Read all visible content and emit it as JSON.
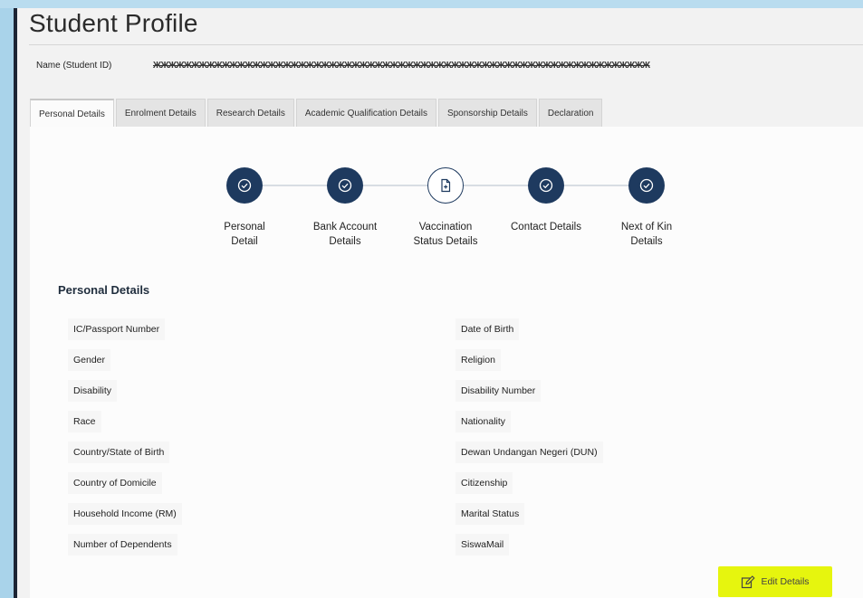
{
  "page": {
    "title": "Student Profile"
  },
  "student": {
    "name_label": "Name (Student ID)",
    "name_value": "ЖЖЖЖЖЖЖЖЖЖЖЖЖЖЖЖЖЖЖЖЖЖЖЖЖЖЖЖЖЖЖЖЖЖЖЖЖЖЖЖЖЖЖЖЖЖЖЖЖЖЖЖЖЖЖЖЖЖЖЖЖЖЖЖЖ"
  },
  "tabs": [
    {
      "label": "Personal Details",
      "active": true
    },
    {
      "label": "Enrolment Details"
    },
    {
      "label": "Research Details"
    },
    {
      "label": "Academic Qualification Details"
    },
    {
      "label": "Sponsorship Details"
    },
    {
      "label": "Declaration"
    }
  ],
  "stepper": {
    "steps": [
      {
        "label_line1": "Personal",
        "label_line2": "Detail",
        "state": "done",
        "icon": "check-circle-icon"
      },
      {
        "label_line1": "Bank Account",
        "label_line2": "Details",
        "state": "done",
        "icon": "check-circle-icon"
      },
      {
        "label_line1": "Vaccination",
        "label_line2": "Status Details",
        "state": "current",
        "icon": "document-plus-icon"
      },
      {
        "label_line1": "Contact Details",
        "label_line2": "",
        "state": "done",
        "icon": "check-circle-icon"
      },
      {
        "label_line1": "Next of Kin",
        "label_line2": "Details",
        "state": "done",
        "icon": "check-circle-icon"
      }
    ],
    "done_color": "#1e3a5f"
  },
  "section": {
    "title": "Personal Details"
  },
  "fields_left": [
    "IC/Passport Number",
    "Gender",
    "Disability",
    "Race",
    "Country/State of Birth",
    "Country of Domicile",
    "Household Income (RM)",
    "Number of Dependents"
  ],
  "fields_right": [
    "Date of Birth",
    "Religion",
    "Disability Number",
    "Nationality",
    "Dewan Undangan Negeri (DUN)",
    "Citizenship",
    "Marital Status",
    "SiswaMail"
  ],
  "actions": {
    "edit_label": "Edit Details",
    "edit_color": "#e6f50e",
    "edit_icon": "edit-icon"
  }
}
